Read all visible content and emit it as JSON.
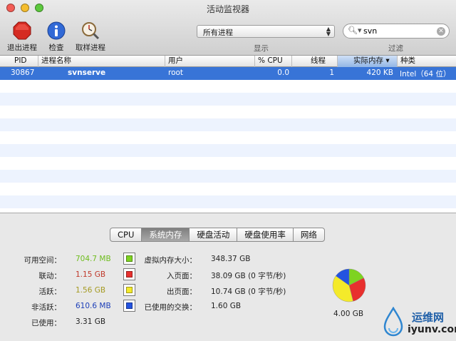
{
  "window": {
    "title": "活动监视器"
  },
  "toolbar": {
    "quit_label": "退出进程",
    "inspect_label": "检查",
    "sample_label": "取样进程",
    "filter_value": "所有进程",
    "show_label": "显示",
    "search_value": "svn",
    "filter_label": "过滤"
  },
  "table": {
    "columns": [
      "PID",
      "进程名称",
      "用户",
      "% CPU",
      "线程",
      "实际内存 ▾",
      "种类"
    ],
    "rows": [
      {
        "pid": "30867",
        "name": "svnserve",
        "user": "root",
        "cpu": "0.0",
        "threads": "1",
        "real_mem": "420 KB",
        "kind": "Intel（64 位）"
      }
    ]
  },
  "tabs": [
    "CPU",
    "系统内存",
    "硬盘活动",
    "硬盘使用率",
    "网络"
  ],
  "selected_tab": 1,
  "memory": {
    "stats": [
      {
        "label": "可用空间：",
        "value": "704.7 MB",
        "color": "#6fbd1e",
        "swatch": "#7ed321"
      },
      {
        "label": "联动：",
        "value": "1.15 GB",
        "color": "#c0392b",
        "swatch": "#e8302e"
      },
      {
        "label": "活跃：",
        "value": "1.56 GB",
        "color": "#a59a22",
        "swatch": "#f4ea2a"
      },
      {
        "label": "非活跃：",
        "value": "610.6 MB",
        "color": "#1d3fb8",
        "swatch": "#2453e0"
      },
      {
        "label": "已使用：",
        "value": "3.31 GB",
        "color": "#222222"
      }
    ],
    "vm": [
      {
        "label": "虚拟内存大小：",
        "value": "348.37 GB"
      },
      {
        "label": "入页面：",
        "value": "38.09 GB (0 字节/秒)"
      },
      {
        "label": "出页面：",
        "value": "10.74 GB (0 字节/秒)"
      },
      {
        "label": "已使用的交换：",
        "value": "1.60 GB"
      }
    ],
    "total": "4.00 GB",
    "pie": [
      {
        "name": "可用空间",
        "value": 0.705,
        "color": "#7ed321"
      },
      {
        "name": "联动",
        "value": 1.15,
        "color": "#e8302e"
      },
      {
        "name": "活跃",
        "value": 1.56,
        "color": "#f4ea2a"
      },
      {
        "name": "非活跃",
        "value": 0.611,
        "color": "#2453e0"
      }
    ]
  },
  "watermark": {
    "title": "运维网",
    "url": "iyunv.com"
  }
}
